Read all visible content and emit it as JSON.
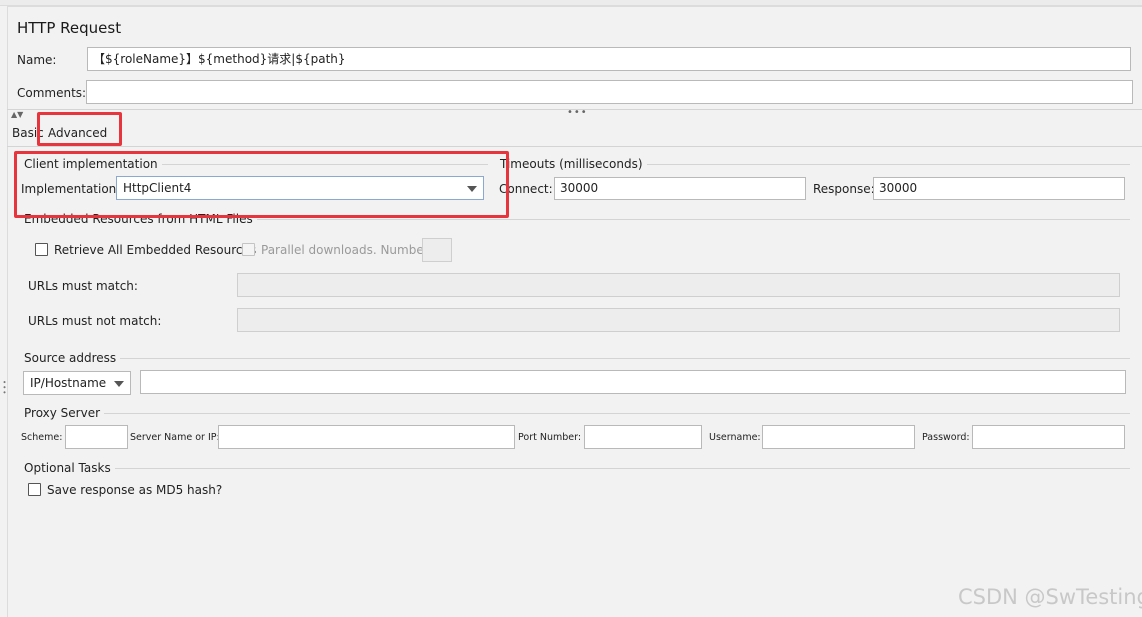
{
  "panel": {
    "title": "HTTP Request",
    "name_label": "Name:",
    "name_value": "【${roleName}】${method}请求|${path}",
    "comments_label": "Comments:",
    "comments_value": ""
  },
  "tabs": [
    {
      "label": "Basic"
    },
    {
      "label": "Advanced"
    }
  ],
  "client_impl": {
    "section": "Client implementation",
    "impl_label": "Implementation:",
    "impl_value": "HttpClient4"
  },
  "timeouts": {
    "section": "Timeouts (milliseconds)",
    "connect_label": "Connect:",
    "connect_value": "30000",
    "response_label": "Response:",
    "response_value": "30000"
  },
  "embedded": {
    "section": "Embedded Resources from HTML Files",
    "retrieve_label": "Retrieve All Embedded Resources",
    "parallel_label": "Parallel downloads. Number:",
    "parallel_value": "",
    "urls_match_label": "URLs must match:",
    "urls_match_value": "",
    "urls_not_match_label": "URLs must not match:",
    "urls_not_match_value": ""
  },
  "source": {
    "section": "Source address",
    "type_value": "IP/Hostname",
    "address_value": ""
  },
  "proxy": {
    "section": "Proxy Server",
    "scheme_label": "Scheme:",
    "scheme_value": "",
    "server_label": "Server Name or IP:",
    "server_value": "",
    "port_label": "Port Number:",
    "port_value": "",
    "username_label": "Username:",
    "username_value": "",
    "password_label": "Password:",
    "password_value": ""
  },
  "optional": {
    "section": "Optional Tasks",
    "md5_label": "Save response as MD5 hash?"
  },
  "watermark": "CSDN @SwTesting",
  "colors": {
    "highlight": "#e8343c",
    "background": "#f2f2f2",
    "tab_accent": "#3d7cc9"
  }
}
